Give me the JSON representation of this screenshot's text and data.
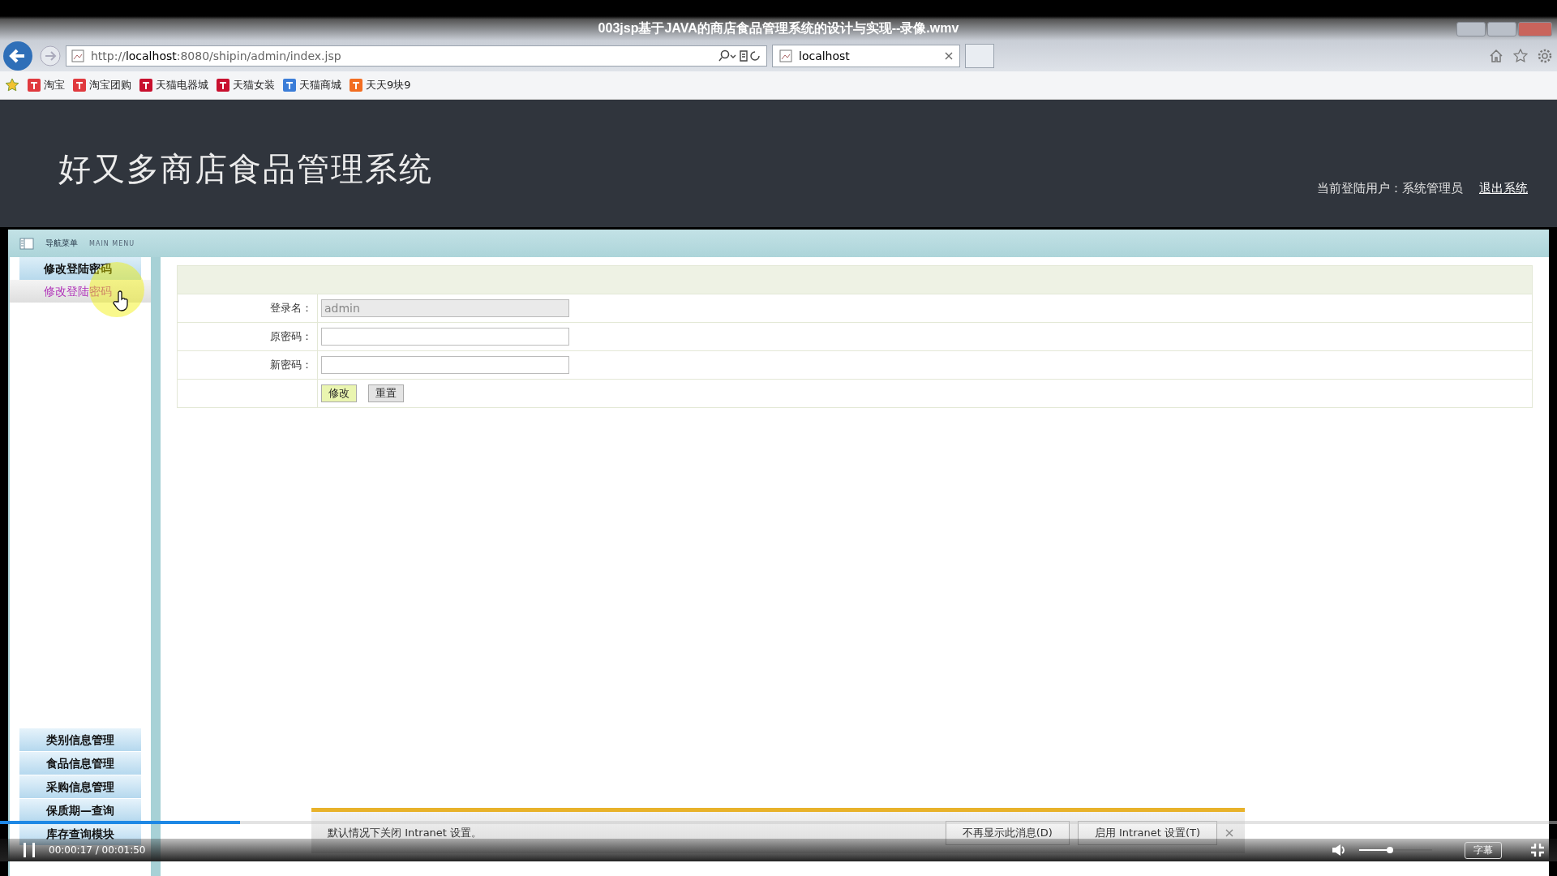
{
  "video": {
    "title": "003jsp基于JAVA的商店食品管理系统的设计与实现--录像.wmv",
    "playing": true,
    "time": "00:00:17 / 00:01:50",
    "progress": {
      "level": 0.154
    },
    "volume": {
      "level": 0.42
    },
    "subtitle_button": "字幕"
  },
  "browser": {
    "url": "http://**localhost**:8080/shipin/admin/index.jsp",
    "tabs": [
      {
        "label": "localhost",
        "selected": true
      }
    ],
    "favorites": [
      {
        "label": "淘宝",
        "color": "#e0393e"
      },
      {
        "label": "淘宝团购",
        "color": "#e0393e"
      },
      {
        "label": "天猫电器城",
        "color": "#c8102e"
      },
      {
        "label": "天猫女装",
        "color": "#c8102e"
      },
      {
        "label": "天猫商城",
        "color": "#3b7dd8"
      },
      {
        "label": "天天9块9",
        "color": "#f26d21"
      }
    ]
  },
  "page": {
    "title": "好又多商店食品管理系统",
    "user_label": "当前登陆用户：系统管理员",
    "logout": "退出系统"
  },
  "menu": {
    "title": "导航菜单",
    "subtitle": "MAIN MENU",
    "top_items": [
      {
        "label": "修改登陆密码",
        "kind": "header",
        "selected": false
      },
      {
        "label": "修改登陆密码",
        "kind": "link",
        "selected": true
      }
    ],
    "bottom_items": [
      "类别信息管理",
      "食品信息管理",
      "采购信息管理",
      "保质期—查询",
      "库存查询模块"
    ]
  },
  "form": {
    "fields": [
      {
        "label": "登录名：",
        "value": "admin",
        "disabled": true
      },
      {
        "label": "原密码：",
        "disabled": false
      },
      {
        "label": "新密码：",
        "disabled": false
      }
    ],
    "buttons": [
      {
        "label": "修改",
        "kind": "primary"
      },
      {
        "label": "重置",
        "kind": "secondary"
      }
    ]
  },
  "notification": {
    "message": "默认情况下关闭 Intranet 设置。",
    "buttons": [
      "不再显示此消息(D)",
      "启用 Intranet 设置(T)"
    ]
  }
}
